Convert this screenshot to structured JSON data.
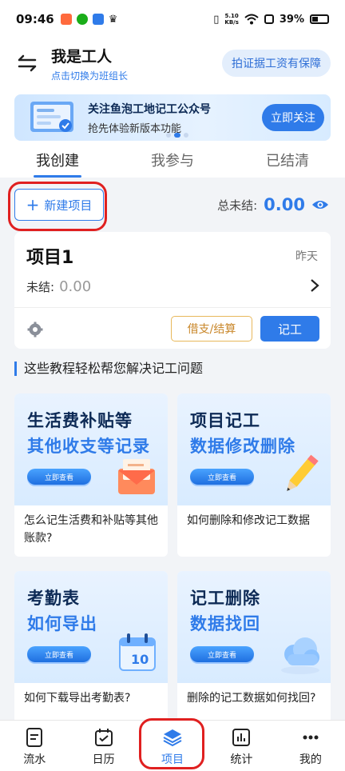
{
  "status_bar": {
    "time": "09:46",
    "net_speed_value": "5.10",
    "net_speed_unit": "KB/s",
    "battery": "39%"
  },
  "header": {
    "title": "我是工人",
    "subtitle": "点击切换为班组长",
    "badge": "拍证据工资有保障"
  },
  "banner": {
    "title": "关注鱼泡工地记工公众号",
    "subtitle": "抢先体验新版本功能",
    "button": "立即关注"
  },
  "tabs": [
    {
      "label": "我创建",
      "active": true
    },
    {
      "label": "我参与",
      "active": false
    },
    {
      "label": "已结清",
      "active": false
    }
  ],
  "actions": {
    "new_project": "新建项目",
    "total_label": "总未结:",
    "total_value": "0.00"
  },
  "project": {
    "name": "项目1",
    "date": "昨天",
    "unpaid_label": "未结:",
    "unpaid_value": "0.00",
    "borrow_button": "借支/结算",
    "record_button": "记工"
  },
  "tutorials": {
    "section_title": "这些教程轻松帮您解决记工问题",
    "items": [
      {
        "line1": "生活费补贴等",
        "line2": "其他收支等记录",
        "button": "立即查看",
        "caption": "怎么记生活费和补贴等其他账款?"
      },
      {
        "line1": "项目记工",
        "line2": "数据修改删除",
        "button": "立即查看",
        "caption": "如何删除和修改记工数据"
      },
      {
        "line1": "考勤表",
        "line2": "如何导出",
        "button": "立即查看",
        "caption": "如何下载导出考勤表?"
      },
      {
        "line1": "记工删除",
        "line2": "数据找回",
        "button": "立即查看",
        "caption": "删除的记工数据如何找回?"
      }
    ]
  },
  "bottom_nav": [
    {
      "label": "流水",
      "icon": "document-icon"
    },
    {
      "label": "日历",
      "icon": "calendar-icon"
    },
    {
      "label": "项目",
      "icon": "layers-icon",
      "active": true
    },
    {
      "label": "统计",
      "icon": "chart-icon"
    },
    {
      "label": "我的",
      "icon": "more-icon"
    }
  ],
  "colors": {
    "accent": "#2f7be9",
    "highlight_ring": "#e02020",
    "warning": "#c9872a"
  }
}
